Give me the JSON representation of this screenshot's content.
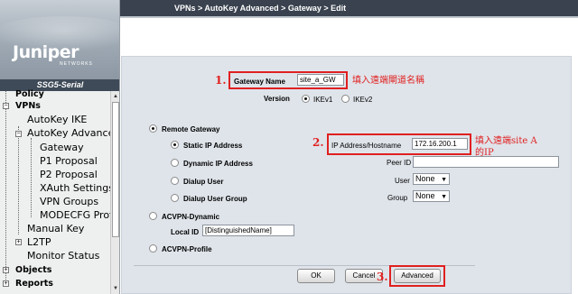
{
  "header": {
    "breadcrumb": "VPNs > AutoKey Advanced > Gateway > Edit"
  },
  "branding": {
    "logo_text": "Juniper",
    "logo_subtext": "NETWORKS",
    "model": "SSG5-Serial"
  },
  "sidebar": {
    "items": [
      {
        "label": "Policy"
      },
      {
        "label": "VPNs"
      },
      {
        "label": "AutoKey IKE"
      },
      {
        "label": "AutoKey Advanced"
      },
      {
        "label": "Gateway"
      },
      {
        "label": "P1 Proposal"
      },
      {
        "label": "P2 Proposal"
      },
      {
        "label": "XAuth Settings"
      },
      {
        "label": "VPN Groups"
      },
      {
        "label": "MODECFG Profile"
      },
      {
        "label": "Manual Key"
      },
      {
        "label": "L2TP"
      },
      {
        "label": "Monitor Status"
      },
      {
        "label": "Objects"
      },
      {
        "label": "Reports"
      }
    ]
  },
  "form": {
    "gateway_name_label": "Gateway Name",
    "gateway_name_value": "site_a_GW",
    "version_label": "Version",
    "ikev1_label": "IKEv1",
    "ikev2_label": "IKEv2",
    "remote_gateway_label": "Remote Gateway",
    "static_ip_label": "Static IP Address",
    "dynamic_ip_label": "Dynamic IP Address",
    "dialup_user_label": "Dialup User",
    "dialup_user_group_label": "Dialup User Group",
    "ip_hostname_label": "IP Address/Hostname",
    "ip_hostname_value": "172.16.200.1",
    "peer_id_label": "Peer ID",
    "peer_id_value": "",
    "user_label": "User",
    "user_value": "None",
    "group_label": "Group",
    "group_value": "None",
    "acvpn_dynamic_label": "ACVPN-Dynamic",
    "local_id_label": "Local ID",
    "local_id_value": "[DistinguishedName]",
    "acvpn_profile_label": "ACVPN-Profile"
  },
  "buttons": {
    "ok": "OK",
    "cancel": "Cancel",
    "advanced": "Advanced"
  },
  "annotations": {
    "step1": "1.",
    "step2": "2.",
    "step3": "3.",
    "note1": "填入遠端閘道名稱",
    "note2_line1": "填入遠端site A",
    "note2_line2": "的IP",
    "color": "#e02020"
  }
}
